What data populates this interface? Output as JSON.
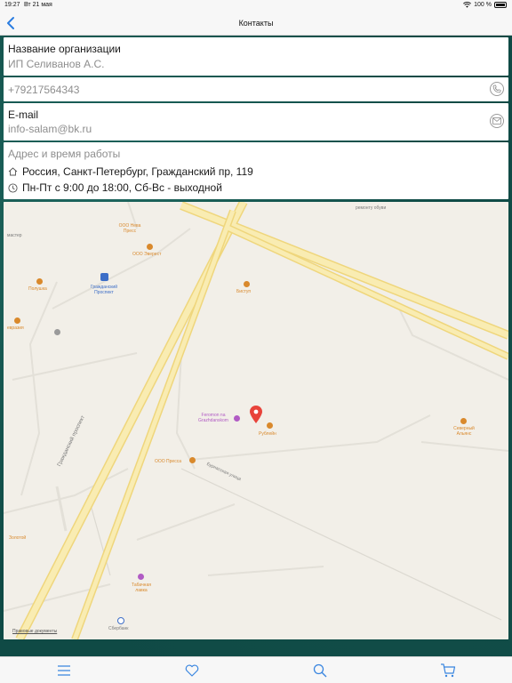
{
  "status_bar": {
    "time": "19:27",
    "date": "Вт 21 мая",
    "battery": "100 %"
  },
  "nav": {
    "title": "Контакты"
  },
  "organization": {
    "label": "Название организации",
    "value": "ИП Селиванов А.С."
  },
  "phone": {
    "value": "+79217564343"
  },
  "email": {
    "label": "E-mail",
    "value": "info-salam@bk.ru"
  },
  "address": {
    "label": "Адрес и время работы",
    "address": "Россия, Санкт-Петербург, Гражданский пр, 119",
    "hours": "Пн-Пт с 9:00 до 18:00, Сб-Вс - выходной"
  },
  "map": {
    "labels": {
      "remont": "ремонту обуви",
      "neva_press": "ООО Нева Пресс",
      "everest": "ООО Эверест",
      "master": "мастер",
      "poluška": "Полушка",
      "metro": "Гражданский Проспект",
      "bistup": "Биступ",
      "evrazia": "евразия",
      "feromon": "Feromon na Grazhdanskom",
      "rublejn": "Рублейн",
      "severny": "Северный Альянс",
      "pressa": "ООО Пресса",
      "prospekt": "Гражданский проспект",
      "bolotnaya": "Бурнасская улица",
      "zoloto": "Золотой",
      "tabak": "Табачная лавка",
      "sberbank": "Сбербанк",
      "legal": "Правовые документы"
    },
    "colors": {
      "poi_orange": "#d9892c",
      "pin": "#e8433a",
      "road": "#f7e9a8"
    }
  },
  "tabs": [
    "menu-icon",
    "heart-icon",
    "search-icon",
    "cart-icon"
  ]
}
